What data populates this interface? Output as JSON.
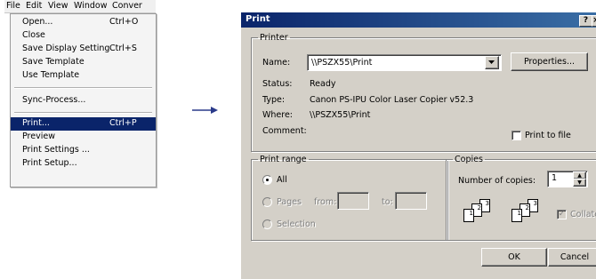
{
  "menubar": {
    "items": [
      "File",
      "Edit",
      "View",
      "Window",
      "Conver"
    ]
  },
  "file_menu": {
    "items": [
      {
        "label": "Open...",
        "shortcut": "Ctrl+O"
      },
      {
        "label": "Close",
        "shortcut": ""
      },
      {
        "label": "Save Display Setting",
        "shortcut": "Ctrl+S"
      },
      {
        "label": "Save Template",
        "shortcut": ""
      },
      {
        "label": "Use Template",
        "shortcut": ""
      },
      {
        "label": "Sync-Process...",
        "shortcut": ""
      },
      {
        "label": "Print...",
        "shortcut": "Ctrl+P"
      },
      {
        "label": "Preview",
        "shortcut": ""
      },
      {
        "label": "Print Settings ...",
        "shortcut": ""
      },
      {
        "label": "Print Setup...",
        "shortcut": ""
      }
    ]
  },
  "dialog": {
    "title": "Print",
    "help_btn": "?",
    "close_btn": "×",
    "printer": {
      "legend": "Printer",
      "name_label": "Name:",
      "name_value": "\\\\PSZX55\\Print",
      "properties_label": "Properties...",
      "status_label": "Status:",
      "status_value": "Ready",
      "type_label": "Type:",
      "type_value": "Canon PS-IPU Color Laser Copier v52.3",
      "where_label": "Where:",
      "where_value": "\\\\PSZX55\\Print",
      "comment_label": "Comment:",
      "print_to_file_label": "Print to file"
    },
    "print_range": {
      "legend": "Print range",
      "all_label": "All",
      "pages_label": "Pages",
      "from_label": "from:",
      "to_label": "to:",
      "selection_label": "Selection"
    },
    "copies": {
      "legend": "Copies",
      "number_label": "Number of copies:",
      "number_value": "1",
      "collate_label": "Collate",
      "page_numbers": [
        "1",
        "2",
        "3"
      ]
    },
    "ok_label": "OK",
    "cancel_label": "Cancel"
  }
}
